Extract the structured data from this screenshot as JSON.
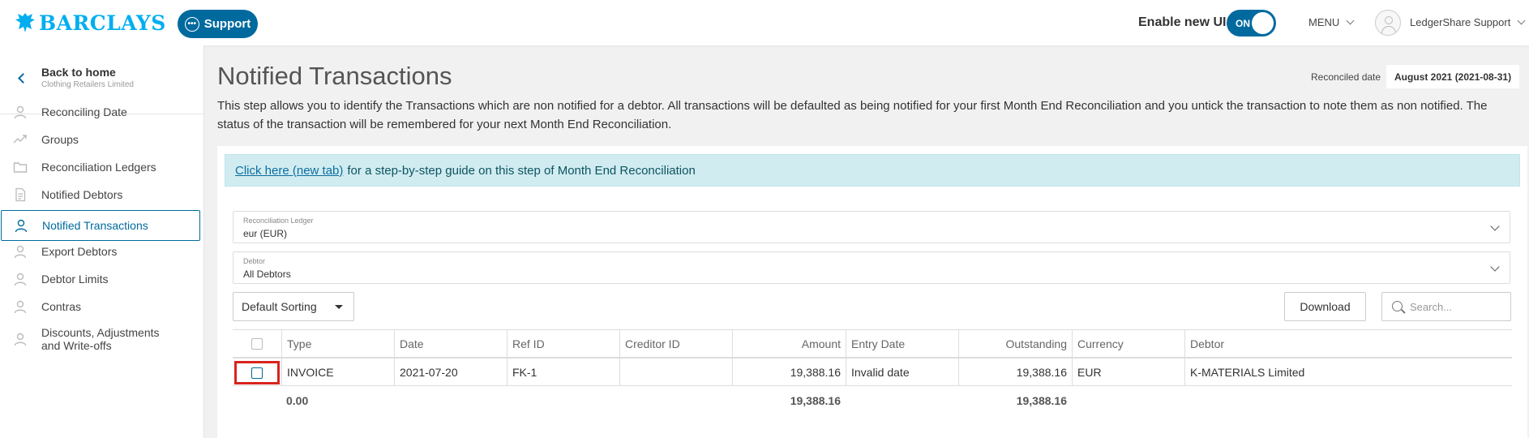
{
  "header": {
    "brand": "BARCLAYS",
    "support_label": "Support",
    "enable_ui_label": "Enable new UI",
    "toggle_state": "ON",
    "menu_label": "MENU",
    "user_name": "LedgerShare Support",
    "brand_color": "#00aeef",
    "accent_color": "#006a9e"
  },
  "sidebar": {
    "back_title": "Back to home",
    "back_subtitle": "Clothing Retailers Limited",
    "items": [
      {
        "label": "Reconciling Date",
        "icon": "user-icon"
      },
      {
        "label": "Groups",
        "icon": "trend-icon"
      },
      {
        "label": "Reconciliation Ledgers",
        "icon": "folder-icon"
      },
      {
        "label": "Notified Debtors",
        "icon": "document-icon"
      },
      {
        "label": "Notified Transactions",
        "icon": "user-icon",
        "active": true
      },
      {
        "label": "Export Debtors",
        "icon": "user-icon"
      },
      {
        "label": "Debtor Limits",
        "icon": "user-icon"
      },
      {
        "label": "Contras",
        "icon": "user-icon"
      },
      {
        "label": "Discounts, Adjustments and Write-offs",
        "icon": "user-icon"
      }
    ]
  },
  "main": {
    "title": "Notified Transactions",
    "reconciled_label": "Reconciled date",
    "reconciled_value": "August 2021 (2021-08-31)",
    "description": "This step allows you to identify the Transactions which are non notified for a debtor. All transactions will be defaulted as being notified for your first Month End Reconciliation and you untick the transaction to note them as non notified. The status of the transaction will be remembered for your next Month End Reconciliation.",
    "guide_link": "Click here (new tab)",
    "guide_text": "for a step-by-step guide on this step of Month End Reconciliation",
    "ledger_label": "Reconciliation Ledger",
    "ledger_value": "eur (EUR)",
    "debtor_label": "Debtor",
    "debtor_value": "All Debtors",
    "sort_label": "Default Sorting",
    "download_label": "Download",
    "search_placeholder": "Search..."
  },
  "table": {
    "columns": [
      "Type",
      "Date",
      "Ref ID",
      "Creditor ID",
      "Amount",
      "Entry Date",
      "Outstanding",
      "Currency",
      "Debtor"
    ],
    "rows": [
      {
        "type": "INVOICE",
        "date": "2021-07-20",
        "ref_id": "FK-1",
        "creditor_id": "",
        "amount": "19,388.16",
        "entry_date": "Invalid date",
        "outstanding": "19,388.16",
        "currency": "EUR",
        "debtor": "K-MATERIALS Limited"
      }
    ],
    "totals": {
      "selected": "0.00",
      "amount": "19,388.16",
      "outstanding": "19,388.16"
    }
  }
}
